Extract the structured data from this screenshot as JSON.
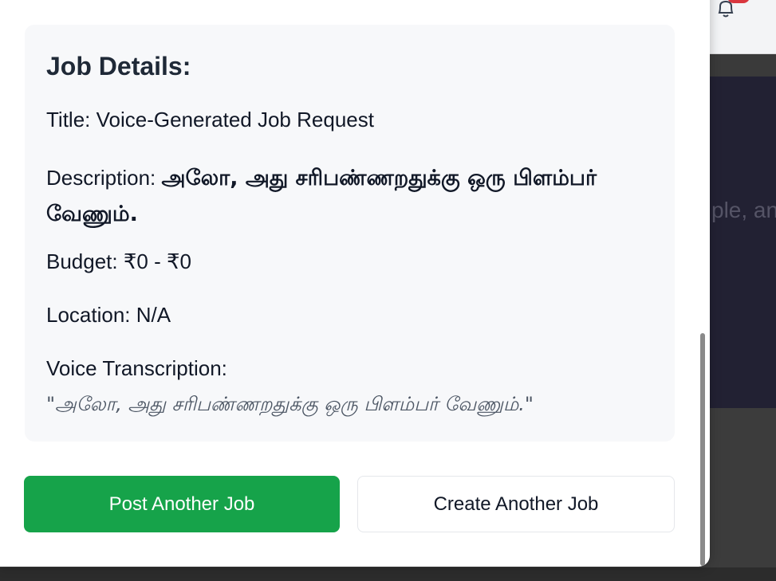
{
  "background": {
    "hero_text": "ple, an",
    "icons": {
      "notifications": "bell-icon"
    },
    "colors": {
      "hero": "#222133",
      "badge": "#d9363e"
    }
  },
  "modal": {
    "details_heading": "Job Details:",
    "title_label": "Title:",
    "title_value": "Voice-Generated Job Request",
    "description_label": "Description:",
    "description_value": "அலோ, அது சரிபண்ணறதுக்கு ஒரு பிளம்பர் வேணும்.",
    "budget_label": "Budget:",
    "budget_value": "₹0 - ₹0",
    "location_label": "Location:",
    "location_value": "N/A",
    "transcription_label": "Voice Transcription:",
    "transcription_value": "\"அலோ, அது சரிபண்ணறதுக்கு ஒரு பிளம்பர் வேணும்.\"",
    "post_another_label": "Post Another Job",
    "create_another_label": "Create Another Job"
  },
  "colors": {
    "primary_button": "#16a34a",
    "card_background": "#f7f8fa"
  }
}
